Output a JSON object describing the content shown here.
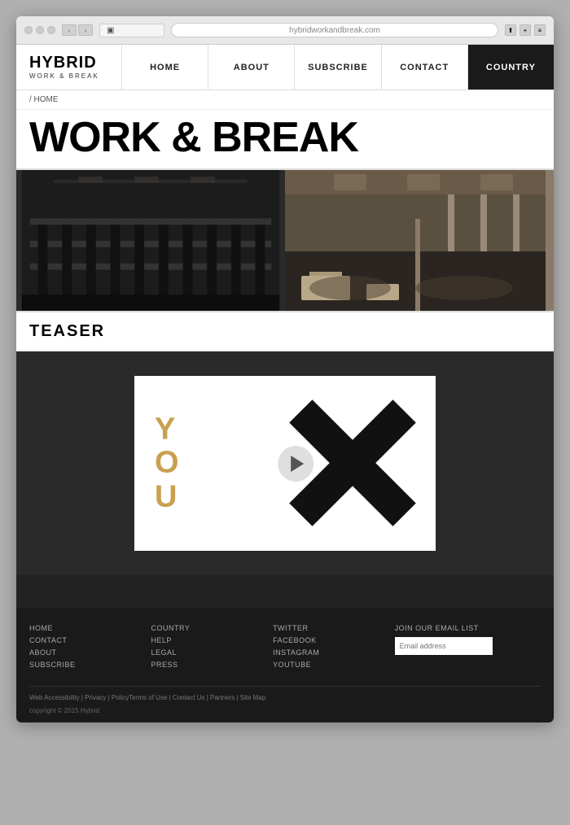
{
  "browser": {
    "address": "hybridworkandbreak.com"
  },
  "header": {
    "logo": "HYBRID",
    "logo_sub": "WORK & BREAK",
    "nav": [
      {
        "label": "HOME"
      },
      {
        "label": "ABOUT"
      },
      {
        "label": "SUBSCRIBE"
      },
      {
        "label": "CONTACT"
      },
      {
        "label": "COUNTRY"
      }
    ]
  },
  "breadcrumb": "/ HOME",
  "page_title": "WORK & BREAK",
  "teaser": {
    "title": "TEASER"
  },
  "video": {
    "letters": [
      "Y",
      "O",
      "U"
    ],
    "x_letter": "X",
    "play_label": "▶"
  },
  "footer": {
    "col1": [
      {
        "label": "HOME"
      },
      {
        "label": "CONTACT"
      },
      {
        "label": "ABOUT"
      },
      {
        "label": "SUBSCRIBE"
      }
    ],
    "col2": [
      {
        "label": "COUNTRY"
      },
      {
        "label": "HELP"
      },
      {
        "label": "LEGAL"
      },
      {
        "label": "PRESS"
      }
    ],
    "col3": [
      {
        "label": "TWITTER"
      },
      {
        "label": "FACEBOOK"
      },
      {
        "label": "INSTAGRAM"
      },
      {
        "label": "YOUTUBE"
      }
    ],
    "email_label": "JOIN OUR EMAIL LIST",
    "email_placeholder": "Email address",
    "legal_text": "Web Accessibility  |  Privacy  |  PolicyTerms of Use  |  Contact Us  |  Partners  |  Site Map",
    "copyright": "copyright © 2015  Hybrid"
  }
}
